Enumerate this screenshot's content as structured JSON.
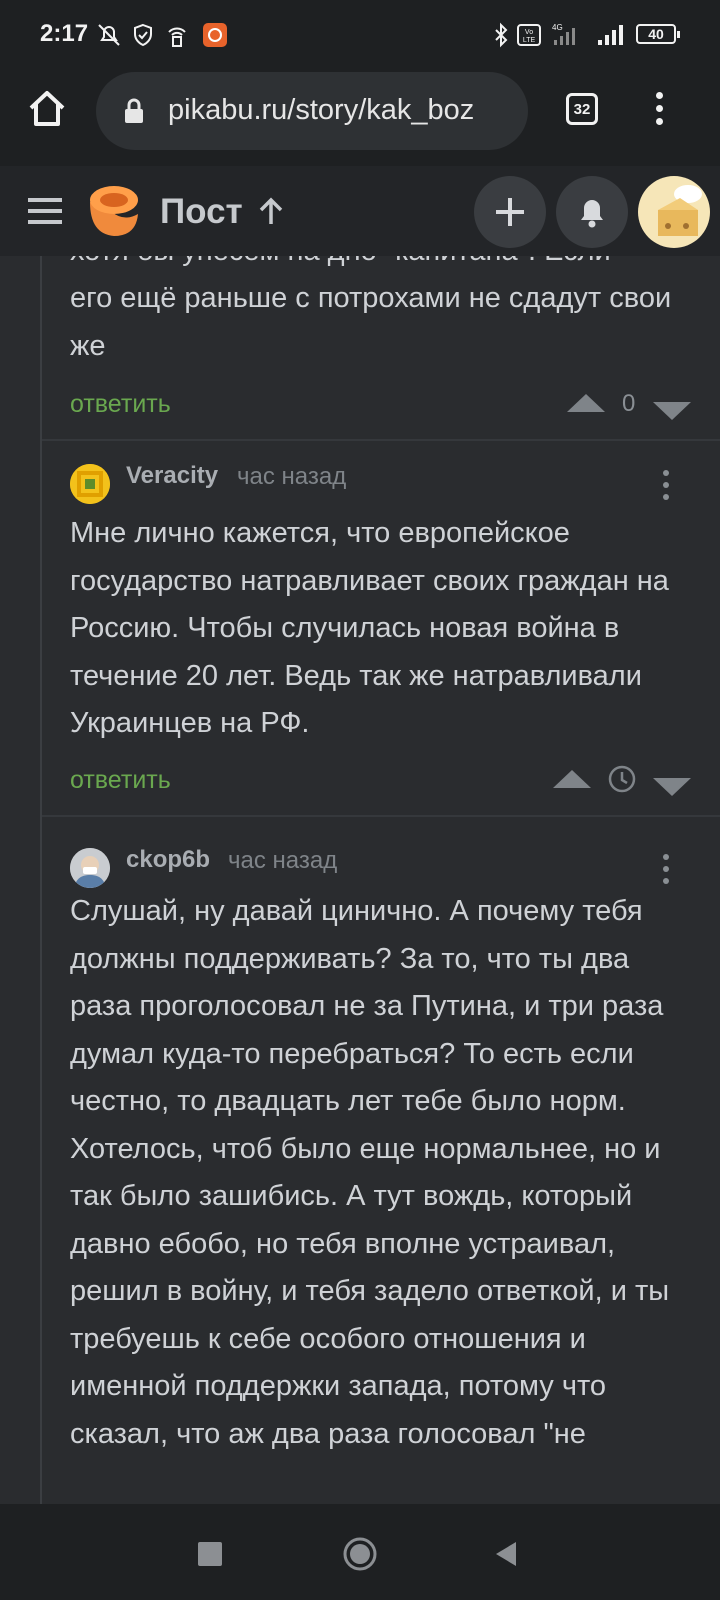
{
  "status_bar": {
    "time": "2:17",
    "battery": "40"
  },
  "browser": {
    "url": "pikabu.ru/story/kak_boz",
    "tab_count": "32"
  },
  "header": {
    "title": "Пост"
  },
  "comments": [
    {
      "text_partial_top": "хотя бы унесем на дно \"капитана\". Если",
      "text": "его ещё раньше с потрохами не сдадут свои же",
      "reply_label": "ответить",
      "rating": "0"
    },
    {
      "author": "Veracity",
      "time": "час назад",
      "text": "Мне лично кажется, что европейское государство натравливает своих граждан на Россию. Чтобы случилась новая война в течение 20 лет. Ведь так же натравливали Украинцев на РФ.",
      "reply_label": "ответить"
    },
    {
      "author": "ckop6b",
      "time": "час назад",
      "text": "Слушай, ну давай цинично. А почему тебя должны поддерживать? За то, что ты два раза проголосовал не за Путина, и три раза думал куда-то перебраться? То есть если честно, то двадцать лет тебе было норм. Хотелось, чтоб было еще нормальнее, но и так было зашибись. А тут вождь, который давно ебобо, но тебя вполне устраивал, решил в войну, и тебя задело ответкой, и ты требуешь к себе особого отношения и именной поддержки запада, потому что сказал, что аж два раза голосовал \"не"
    }
  ],
  "colors": {
    "background": "#2a2c2f",
    "reply_green": "#6aa84f",
    "logo_orange": "#f08a3c"
  }
}
